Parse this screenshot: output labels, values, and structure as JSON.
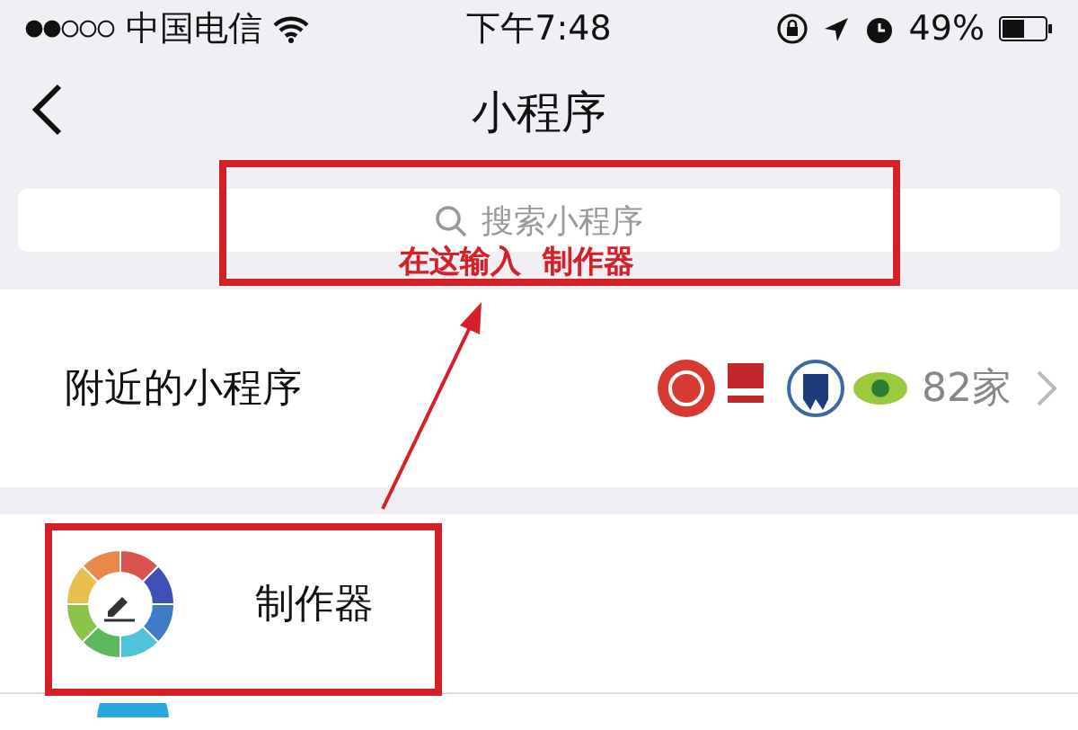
{
  "status_bar": {
    "carrier": "中国电信",
    "time": "下午7:48",
    "battery": "49%"
  },
  "nav": {
    "title": "小程序"
  },
  "search": {
    "placeholder": "搜索小程序"
  },
  "nearby": {
    "label": "附近的小程序",
    "count": "82家"
  },
  "apps": [
    {
      "name": "制作器"
    }
  ],
  "annotation": {
    "text": "在这输入  制作器"
  }
}
